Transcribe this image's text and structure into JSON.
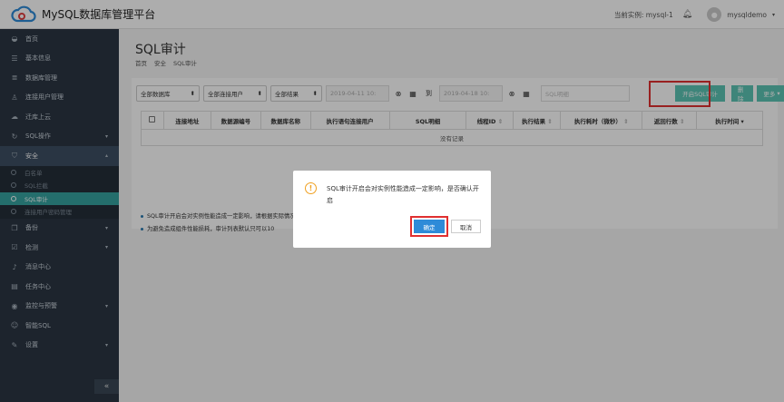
{
  "app": {
    "title": "MySQL数据库管理平台"
  },
  "topbar": {
    "instance_label": "当前实例: mysql-1",
    "user": "mysqldemo"
  },
  "sidebar": {
    "items": [
      {
        "label": "首页",
        "icon": "dashboard-icon"
      },
      {
        "label": "基本信息",
        "icon": "list-icon"
      },
      {
        "label": "数据库管理",
        "icon": "database-icon"
      },
      {
        "label": "连接用户管理",
        "icon": "user-icon"
      },
      {
        "label": "迁库上云",
        "icon": "cloud-upload-icon"
      },
      {
        "label": "SQL操作",
        "icon": "sql-icon"
      },
      {
        "label": "安全",
        "icon": "shield-icon"
      }
    ],
    "security_sub": [
      {
        "label": "白名单"
      },
      {
        "label": "SQL拦截"
      },
      {
        "label": "SQL审计"
      },
      {
        "label": "连接用户密码管理"
      }
    ],
    "items2": [
      {
        "label": "备份",
        "icon": "copy-icon"
      },
      {
        "label": "检测",
        "icon": "check-icon"
      },
      {
        "label": "消息中心",
        "icon": "bell-icon"
      },
      {
        "label": "任务中心",
        "icon": "task-icon"
      },
      {
        "label": "监控与预警",
        "icon": "eye-icon"
      },
      {
        "label": "智能SQL",
        "icon": "smart-icon"
      },
      {
        "label": "设置",
        "icon": "wrench-icon"
      }
    ],
    "collapse": "«"
  },
  "page": {
    "title": "SQL审计",
    "breadcrumb": [
      "首页",
      "安全",
      "SQL审计"
    ]
  },
  "toolbar": {
    "db_select": "全部数据库",
    "user_select": "全部连接用户",
    "result_select": "全部结果",
    "date_from": "2019-04-11 10:",
    "to": "到",
    "date_to": "2019-04-18 10:",
    "search_placeholder": "SQL明细",
    "enable_btn": "开启SQL审计",
    "delete_btn": "删除",
    "more_btn": "更多"
  },
  "table": {
    "headers": [
      "连接地址",
      "数据源编号",
      "数据库名称",
      "执行语句连接用户",
      "SQL明细",
      "线程ID",
      "执行结果",
      "执行耗时（微秒）",
      "返回行数",
      "执行时间"
    ],
    "empty": "没有记录"
  },
  "notes": [
    "SQL审计开启会对实例性能造成一定影响，请根据实际情况确认是否开启",
    "为避免造成组件性能损耗，审计列表默认只可以10"
  ],
  "dialog": {
    "message": "SQL审计开启会对实例性能造成一定影响，是否确认开启",
    "ok": "确定",
    "cancel": "取消"
  }
}
